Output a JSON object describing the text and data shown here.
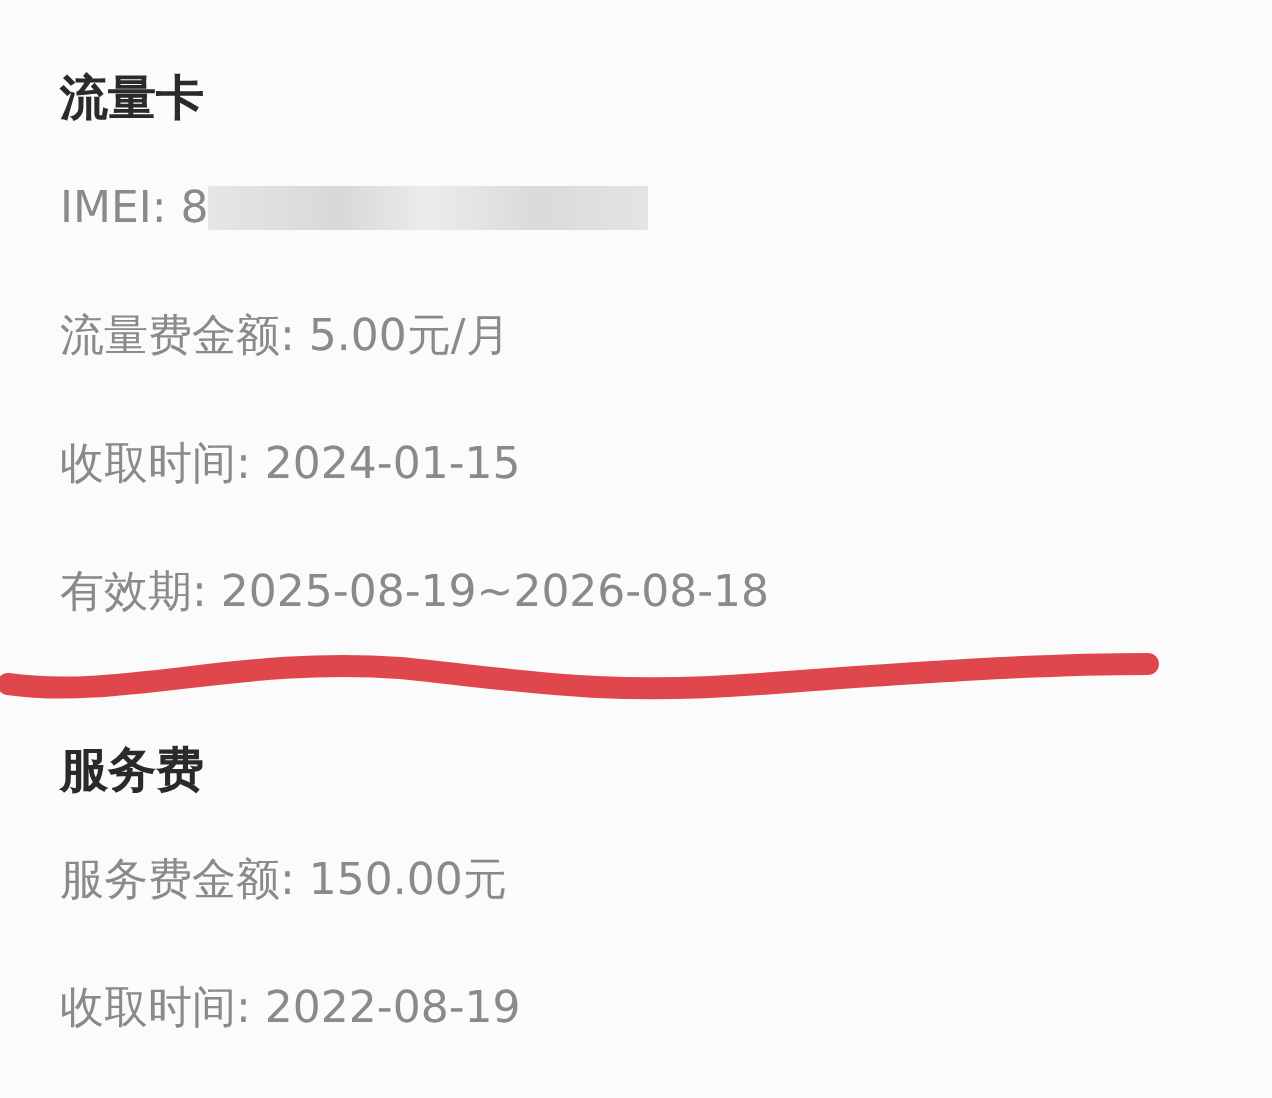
{
  "sections": [
    {
      "title": "流量卡",
      "marked": true,
      "rows": [
        {
          "kind": "redacted",
          "text": "IMEI: 8"
        },
        {
          "kind": "text",
          "text": "流量费金额: 5.00元/月"
        },
        {
          "kind": "text",
          "text": "收取时间: 2024-01-15"
        },
        {
          "kind": "text",
          "text": "有效期: 2025-08-19~2026-08-18"
        }
      ]
    },
    {
      "title": "服务费",
      "marked": false,
      "rows": [
        {
          "kind": "text",
          "text": "服务费金额: 150.00元"
        },
        {
          "kind": "text",
          "text": "收取时间: 2022-08-19"
        }
      ]
    }
  ]
}
